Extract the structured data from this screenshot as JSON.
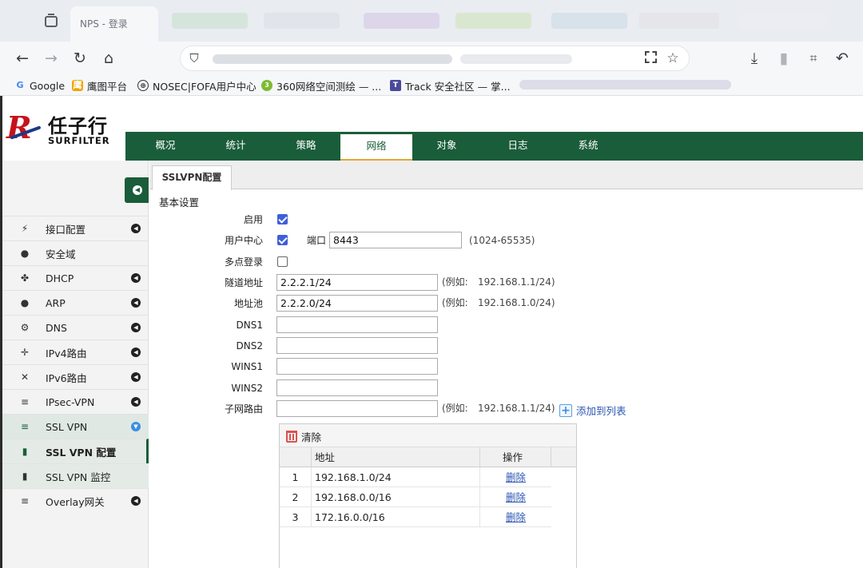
{
  "browser": {
    "tab_title": "NPS - 登录",
    "bookmarks": [
      {
        "label": "Google",
        "icon": "google-icon",
        "color": "#4285f4"
      },
      {
        "label": "鹰图平台",
        "icon": "eagle-icon",
        "color": "#f0a500"
      },
      {
        "label": "NOSEC|FOFA用户中心",
        "icon": "globe-icon",
        "color": "#333333"
      },
      {
        "label": "360网络空间测绘 — ...",
        "icon": "360-icon",
        "color": "#7dbb2f"
      },
      {
        "label": "Track 安全社区 — 掌...",
        "icon": "shield-icon",
        "color": "#4a4a9a"
      }
    ]
  },
  "logo": {
    "cn": "任子行",
    "en": "SURFILTER"
  },
  "topnav": {
    "items": [
      "概况",
      "统计",
      "策略",
      "网络",
      "对象",
      "日志",
      "系统"
    ],
    "active_index": 3
  },
  "sidebar": {
    "items": [
      {
        "label": "接口配置",
        "icon": "plug-icon",
        "arrow": true
      },
      {
        "label": "安全域",
        "icon": "globe-icon",
        "arrow": false
      },
      {
        "label": "DHCP",
        "icon": "sitemap-icon",
        "arrow": true
      },
      {
        "label": "ARP",
        "icon": "globe-icon",
        "arrow": true
      },
      {
        "label": "DNS",
        "icon": "cogs-icon",
        "arrow": true
      },
      {
        "label": "IPv4路由",
        "icon": "arrows-icon",
        "arrow": true
      },
      {
        "label": "IPv6路由",
        "icon": "expand-icon",
        "arrow": true
      },
      {
        "label": "IPsec-VPN",
        "icon": "list-icon",
        "arrow": true
      },
      {
        "label": "SSL VPN",
        "icon": "list-icon",
        "arrow": true,
        "open": true
      },
      {
        "label": "SSL VPN 配置",
        "icon": "file-icon",
        "sub": true,
        "selected": true
      },
      {
        "label": "SSL VPN 监控",
        "icon": "file-icon",
        "sub": true
      },
      {
        "label": "Overlay网关",
        "icon": "list-icon",
        "arrow": true
      }
    ]
  },
  "content": {
    "tab_label": "SSLVPN配置",
    "section_title": "基本设置",
    "enable": {
      "label": "启用",
      "checked": true
    },
    "user_center": {
      "label": "用户中心",
      "checked": true,
      "port_label": "端口",
      "port_value": "8443",
      "port_hint": "(1024-65535)"
    },
    "multi_login": {
      "label": "多点登录",
      "checked": false
    },
    "tunnel_addr": {
      "label": "隧道地址",
      "value": "2.2.2.1/24",
      "hint_prefix": "(例如:",
      "hint_value": "192.168.1.1/24)"
    },
    "addr_pool": {
      "label": "地址池",
      "value": "2.2.2.0/24",
      "hint_prefix": "(例如:",
      "hint_value": "192.168.1.0/24)"
    },
    "dns1": {
      "label": "DNS1",
      "value": ""
    },
    "dns2": {
      "label": "DNS2",
      "value": ""
    },
    "wins1": {
      "label": "WINS1",
      "value": ""
    },
    "wins2": {
      "label": "WINS2",
      "value": ""
    },
    "subnet_route": {
      "label": "子网路由",
      "value": "",
      "hint_prefix": "(例如:",
      "hint_value": "192.168.1.1/24)"
    },
    "add_to_list": "添加到列表",
    "grid": {
      "clear_label": "清除",
      "col_addr": "地址",
      "col_op": "操作",
      "rows": [
        {
          "idx": "1",
          "addr": "192.168.1.0/24",
          "op": "删除"
        },
        {
          "idx": "2",
          "addr": "192.168.0.0/16",
          "op": "删除"
        },
        {
          "idx": "3",
          "addr": "172.16.0.0/16",
          "op": "删除"
        }
      ]
    }
  },
  "colors": {
    "brand_green": "#1a5d3a",
    "accent_orange": "#e8a530",
    "link_blue": "#2c56b3",
    "checkbox_blue": "#3f5fd9"
  }
}
